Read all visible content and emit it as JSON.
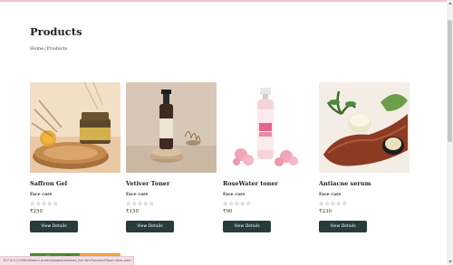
{
  "page": {
    "title": "Products",
    "breadcrumb": [
      "Home",
      "/",
      "Products"
    ]
  },
  "products": [
    {
      "name": "Saffron Gel",
      "category": "Face care",
      "price": "₹250",
      "rating_stars": "☆☆☆☆☆",
      "button_label": "View Details",
      "image": "saffron-gel-jar-image"
    },
    {
      "name": "Vetiver Toner",
      "category": "Face care",
      "price": "₹150",
      "rating_stars": "☆☆☆☆☆",
      "button_label": "View Details",
      "image": "vetiver-toner-bottle-image"
    },
    {
      "name": "RoseWater toner",
      "category": "Face care",
      "price": "₹90",
      "rating_stars": "☆☆☆☆☆",
      "button_label": "View Details",
      "image": "rosewater-spray-bottle-image"
    },
    {
      "name": "Antiacne serum",
      "category": "Face care",
      "price": "₹230",
      "rating_stars": "☆☆☆☆☆",
      "button_label": "View Details",
      "image": "antiacne-cream-jar-image"
    }
  ],
  "status_bar": {
    "url": "127.0.0.1:5500/Swami project/pages/product_list.html?productType=face-care"
  },
  "colors": {
    "button_bg": "#263c3c",
    "topbar": "#f2c4cf",
    "status_bg": "#f4dfe6"
  }
}
